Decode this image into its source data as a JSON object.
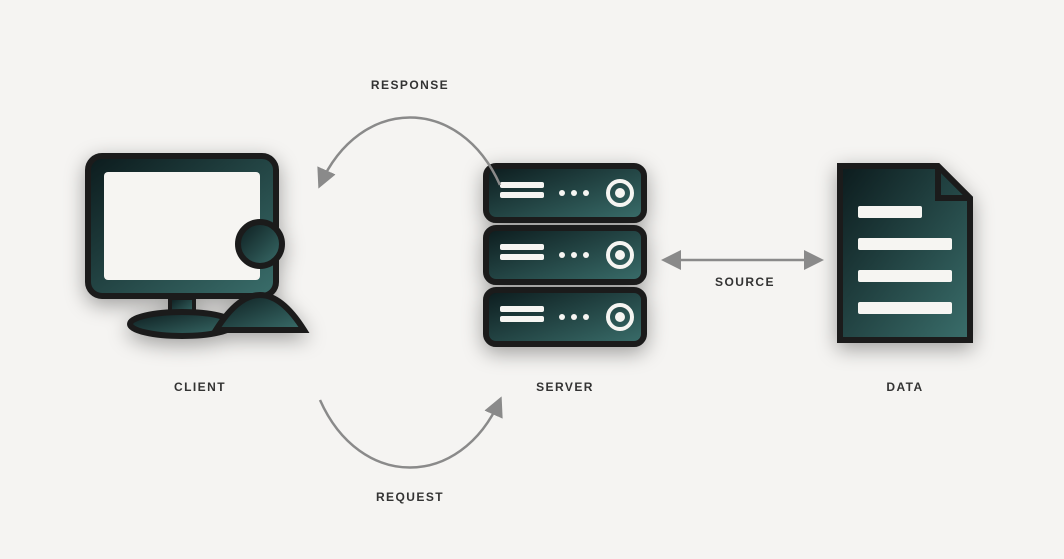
{
  "nodes": {
    "client": {
      "label": "CLIENT"
    },
    "server": {
      "label": "SERVER"
    },
    "data": {
      "label": "DATA"
    }
  },
  "edges": {
    "response": {
      "label": "RESPONSE"
    },
    "request": {
      "label": "REQUEST"
    },
    "source": {
      "label": "SOURCE"
    }
  },
  "palette": {
    "stroke": "#1b1b1b",
    "grad_from": "#0c1b1d",
    "grad_to": "#3a6e6b",
    "background": "#f5f4f2",
    "arrow": "#8a8a8a"
  }
}
